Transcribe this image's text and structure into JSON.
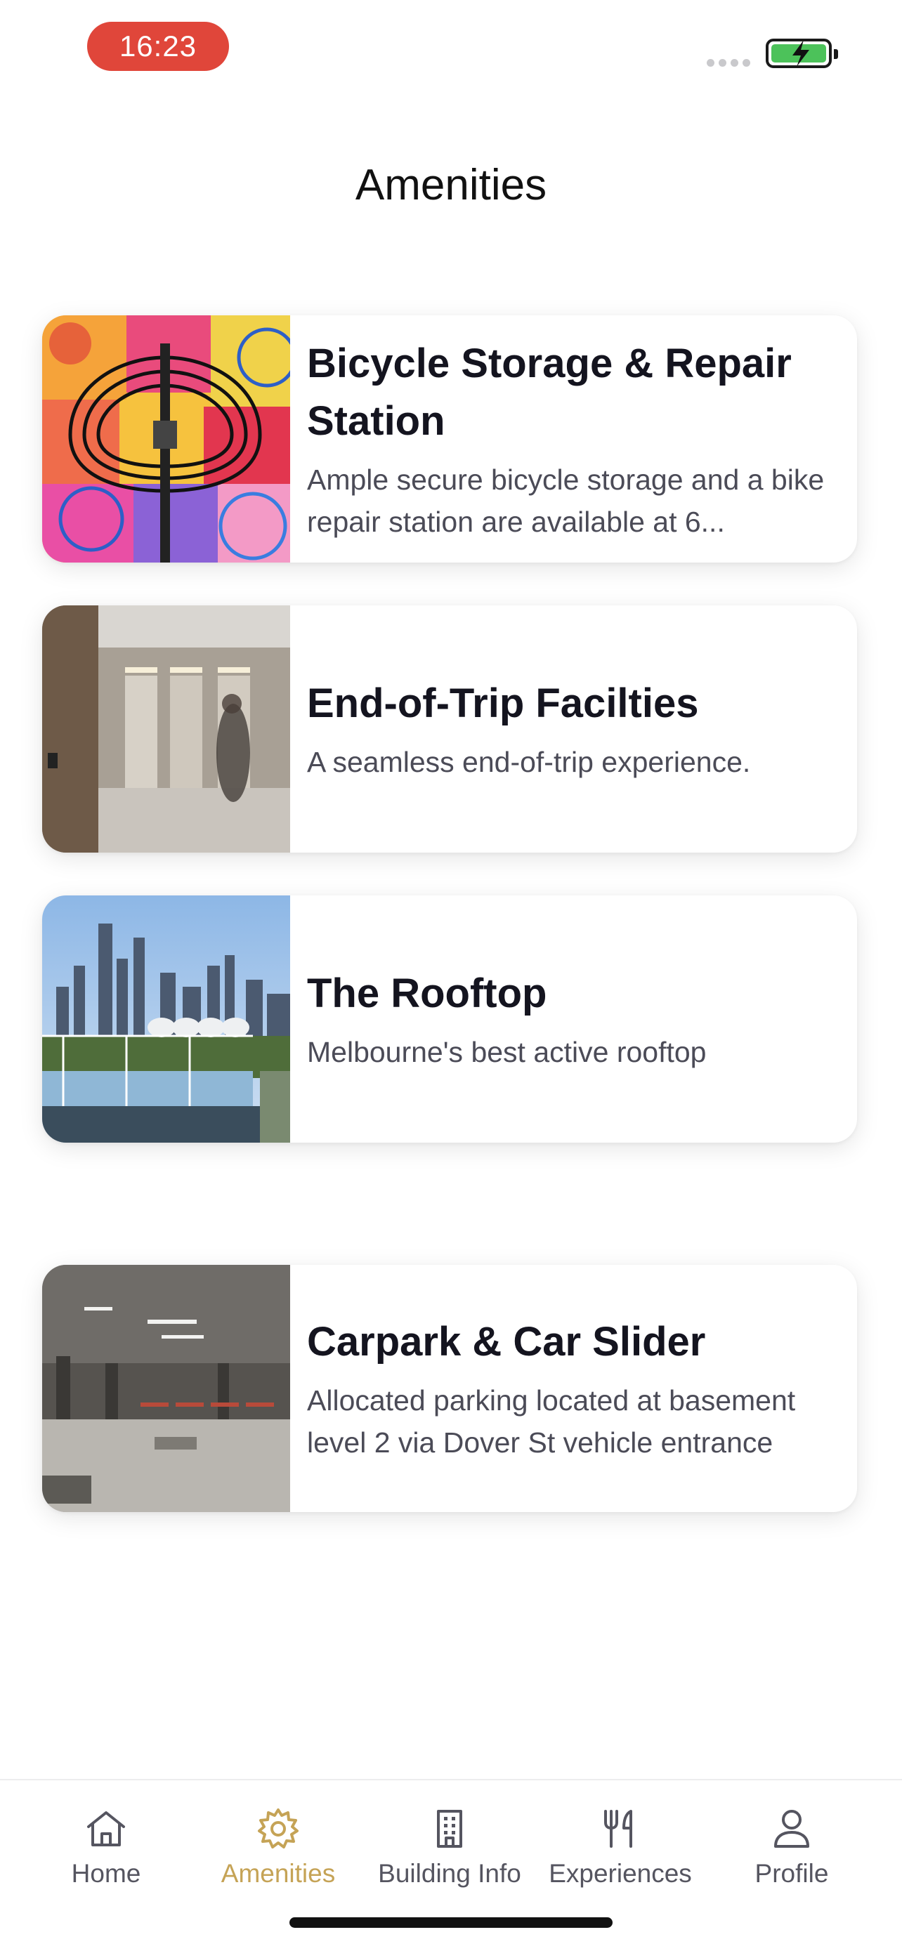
{
  "status": {
    "time": "16:23"
  },
  "header": {
    "title": "Amenities"
  },
  "cards": [
    {
      "title": "Bicycle Storage & Repair Station",
      "description": "Ample secure bicycle storage and a bike repair station are available at 6...",
      "image": "bicycle-rack-mural"
    },
    {
      "title": "End-of-Trip Facilties",
      "description": "A seamless end-of-trip experience.",
      "image": "end-of-trip-showers"
    },
    {
      "title": "The Rooftop",
      "description": "Melbourne's best active rooftop",
      "image": "city-skyline-rooftop"
    },
    {
      "title": "Carpark & Car Slider",
      "description": "Allocated parking located at basement level 2 via Dover St vehicle entrance",
      "image": "basement-carpark"
    }
  ],
  "tabs": [
    {
      "label": "Home",
      "icon": "home-icon",
      "active": false
    },
    {
      "label": "Amenities",
      "icon": "sun-gear-icon",
      "active": true
    },
    {
      "label": "Building Info",
      "icon": "building-icon",
      "active": false
    },
    {
      "label": "Experiences",
      "icon": "fork-knife-icon",
      "active": false
    },
    {
      "label": "Profile",
      "icon": "profile-icon",
      "active": false
    }
  ],
  "colors": {
    "accent": "#c5a356",
    "time_pill": "#e0463a",
    "battery": "#4cc25a"
  }
}
